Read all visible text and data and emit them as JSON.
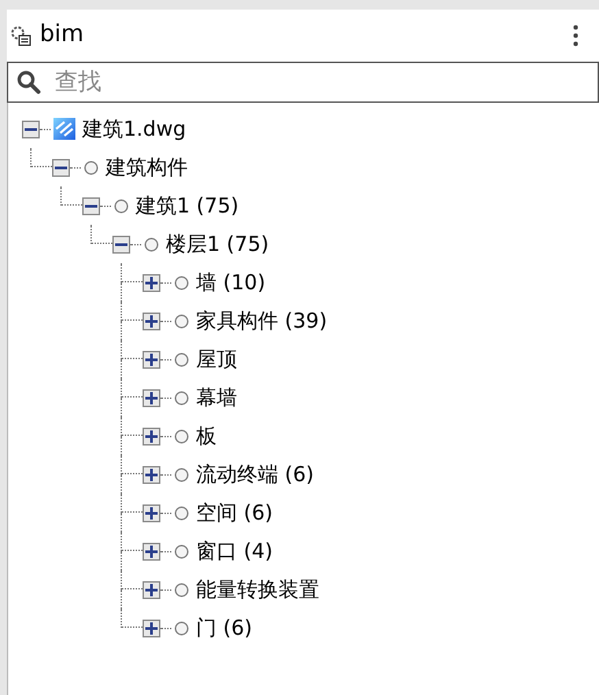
{
  "panel": {
    "title": "bim"
  },
  "search": {
    "placeholder": "查找"
  },
  "tree": [
    {
      "kind": "file",
      "label": "建筑1.dwg",
      "expanded": true,
      "children": [
        {
          "kind": "node",
          "label": "建筑构件",
          "expanded": true,
          "children": [
            {
              "kind": "node",
              "label": "建筑1 (75)",
              "expanded": true,
              "children": [
                {
                  "kind": "node",
                  "label": "楼层1 (75)",
                  "expanded": true,
                  "children": [
                    {
                      "kind": "node",
                      "label": "墙 (10)",
                      "expanded": false
                    },
                    {
                      "kind": "node",
                      "label": "家具构件 (39)",
                      "expanded": false
                    },
                    {
                      "kind": "node",
                      "label": "屋顶",
                      "expanded": false
                    },
                    {
                      "kind": "node",
                      "label": "幕墙",
                      "expanded": false
                    },
                    {
                      "kind": "node",
                      "label": "板",
                      "expanded": false
                    },
                    {
                      "kind": "node",
                      "label": "流动终端 (6)",
                      "expanded": false
                    },
                    {
                      "kind": "node",
                      "label": "空间 (6)",
                      "expanded": false
                    },
                    {
                      "kind": "node",
                      "label": "窗口 (4)",
                      "expanded": false
                    },
                    {
                      "kind": "node",
                      "label": "能量转换装置",
                      "expanded": false
                    },
                    {
                      "kind": "node",
                      "label": "门 (6)",
                      "expanded": false
                    }
                  ]
                }
              ]
            }
          ]
        }
      ]
    }
  ]
}
